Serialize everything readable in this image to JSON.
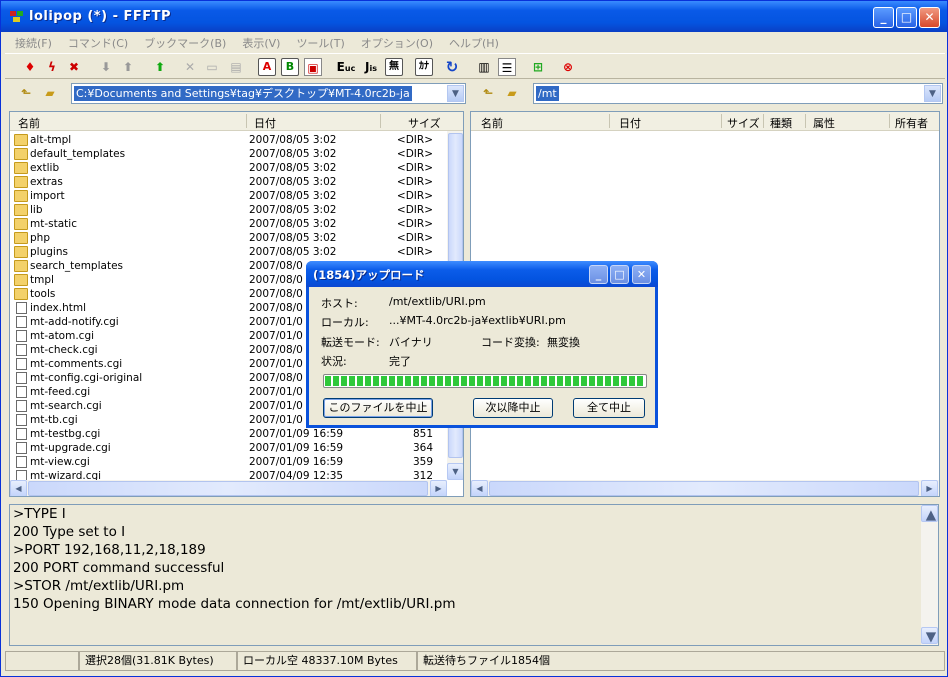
{
  "window": {
    "title": "lolipop (*) - FFFTP"
  },
  "menu": [
    "接続(F)",
    "コマンド(C)",
    "ブックマーク(B)",
    "表示(V)",
    "ツール(T)",
    "オプション(O)",
    "ヘルプ(H)"
  ],
  "toolbar": {
    "icons": [
      "connect-icon",
      "quick-connect-icon",
      "disconnect-icon",
      "download-icon",
      "upload-icon",
      "mirror-upload-icon",
      "delete-icon",
      "rename-icon",
      "mkdir-icon",
      "ascii-mode-icon",
      "binary-mode-icon",
      "auto-mode-icon",
      "euc-icon",
      "jis-icon",
      "no-convert-icon",
      "kana-icon",
      "refresh-icon",
      "list-view-icon",
      "detail-view-icon",
      "tree-icon",
      "stop-icon"
    ],
    "labels": {
      "a": "A",
      "b": "B",
      "euc": "E",
      "euc_sub": "uc",
      "jis": "J",
      "jis_sub": "is",
      "none": "無",
      "kana": "ｶﾅ"
    }
  },
  "local": {
    "path": "C:¥Documents and Settings¥tag¥デスクトップ¥MT-4.0rc2b-ja",
    "columns": {
      "name": "名前",
      "date": "日付",
      "size": "サイズ"
    },
    "files": [
      {
        "name": "alt-tmpl",
        "date": "2007/08/05  3:02",
        "size": "<DIR>",
        "type": "folder"
      },
      {
        "name": "default_templates",
        "date": "2007/08/05  3:02",
        "size": "<DIR>",
        "type": "folder"
      },
      {
        "name": "extlib",
        "date": "2007/08/05  3:02",
        "size": "<DIR>",
        "type": "folder"
      },
      {
        "name": "extras",
        "date": "2007/08/05  3:02",
        "size": "<DIR>",
        "type": "folder"
      },
      {
        "name": "import",
        "date": "2007/08/05  3:02",
        "size": "<DIR>",
        "type": "folder"
      },
      {
        "name": "lib",
        "date": "2007/08/05  3:02",
        "size": "<DIR>",
        "type": "folder"
      },
      {
        "name": "mt-static",
        "date": "2007/08/05  3:02",
        "size": "<DIR>",
        "type": "folder"
      },
      {
        "name": "php",
        "date": "2007/08/05  3:02",
        "size": "<DIR>",
        "type": "folder"
      },
      {
        "name": "plugins",
        "date": "2007/08/05  3:02",
        "size": "<DIR>",
        "type": "folder"
      },
      {
        "name": "search_templates",
        "date": "2007/08/0",
        "size": "",
        "type": "folder"
      },
      {
        "name": "tmpl",
        "date": "2007/08/0",
        "size": "",
        "type": "folder"
      },
      {
        "name": "tools",
        "date": "2007/08/0",
        "size": "",
        "type": "folder"
      },
      {
        "name": "index.html",
        "date": "2007/08/0",
        "size": "",
        "type": "file"
      },
      {
        "name": "mt-add-notify.cgi",
        "date": "2007/01/0",
        "size": "",
        "type": "file"
      },
      {
        "name": "mt-atom.cgi",
        "date": "2007/01/0",
        "size": "",
        "type": "file"
      },
      {
        "name": "mt-check.cgi",
        "date": "2007/08/0",
        "size": "",
        "type": "file"
      },
      {
        "name": "mt-comments.cgi",
        "date": "2007/01/0",
        "size": "",
        "type": "file"
      },
      {
        "name": "mt-config.cgi-original",
        "date": "2007/08/0",
        "size": "",
        "type": "file"
      },
      {
        "name": "mt-feed.cgi",
        "date": "2007/01/0",
        "size": "",
        "type": "file"
      },
      {
        "name": "mt-search.cgi",
        "date": "2007/01/0",
        "size": "",
        "type": "file"
      },
      {
        "name": "mt-tb.cgi",
        "date": "2007/01/0",
        "size": "",
        "type": "file"
      },
      {
        "name": "mt-testbg.cgi",
        "date": "2007/01/09 16:59",
        "size": "851",
        "type": "file"
      },
      {
        "name": "mt-upgrade.cgi",
        "date": "2007/01/09 16:59",
        "size": "364",
        "type": "file"
      },
      {
        "name": "mt-view.cgi",
        "date": "2007/01/09 16:59",
        "size": "359",
        "type": "file"
      },
      {
        "name": "mt-wizard.cgi",
        "date": "2007/04/09 12:35",
        "size": "312",
        "type": "file"
      }
    ]
  },
  "remote": {
    "path": "/mt",
    "columns": {
      "name": "名前",
      "date": "日付",
      "size": "サイズ",
      "kind": "種類",
      "attr": "属性",
      "owner": "所有者"
    }
  },
  "log": [
    ">TYPE I",
    "200 Type set to I",
    ">PORT 192,168,11,2,18,189",
    "200 PORT command successful",
    ">STOR /mt/extlib/URI.pm",
    "150 Opening BINARY mode data connection for /mt/extlib/URI.pm"
  ],
  "status": {
    "selected": "選択28個(31.81K Bytes)",
    "local_free": "ローカル空 48337.10M Bytes",
    "queue": "転送待ちファイル1854個"
  },
  "dialog": {
    "title": "(1854)アップロード",
    "host_label": "ホスト:",
    "host_value": "/mt/extlib/URI.pm",
    "local_label": "ローカル:",
    "local_value": "...¥MT-4.0rc2b-ja¥extlib¥URI.pm",
    "mode_label": "転送モード:",
    "mode_value": "バイナリ",
    "code_label": "コード変換:",
    "code_value": "無変換",
    "state_label": "状況:",
    "state_value": "完了",
    "progress": 1.0,
    "btn_cancel_file": "このファイルを中止",
    "btn_cancel_next": "次以降中止",
    "btn_cancel_all": "全て中止"
  }
}
